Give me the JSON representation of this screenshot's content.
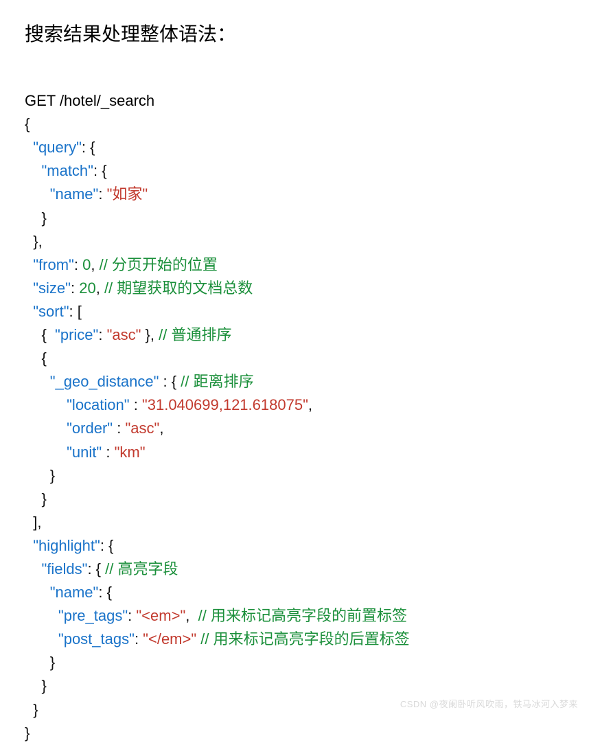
{
  "title": "搜索结果处理整体语法：",
  "request_line": "GET /hotel/_search",
  "braces": {
    "open": "{",
    "close": "}",
    "open_bracket": "[",
    "close_bracket": "]"
  },
  "punct": {
    "colon_space": ": ",
    "colon_space_brace": ": {",
    "colon_space_bracket": ": [",
    "comma": ",",
    "brace_close_comma": "},",
    "bracket_close_comma": "],",
    "space_brace_close_comma": " },",
    "space_colon_space_brace": " : {",
    "space_colon_space": " : ",
    "space": "  "
  },
  "keys": {
    "query": "\"query\"",
    "match": "\"match\"",
    "name": "\"name\"",
    "from": "\"from\"",
    "size": "\"size\"",
    "sort": "\"sort\"",
    "price": "\"price\"",
    "geo_distance": "\"_geo_distance\"",
    "location": "\"location\"",
    "order": "\"order\"",
    "unit": "\"unit\"",
    "highlight": "\"highlight\"",
    "fields": "\"fields\"",
    "pre_tags": "\"pre_tags\"",
    "post_tags": "\"post_tags\""
  },
  "values": {
    "rujia": "\"如家\"",
    "zero": "0",
    "twenty": "20",
    "asc": "\"asc\"",
    "location_val": "\"31.040699,121.618075\"",
    "km": "\"km\"",
    "em_open": "\"<em>\"",
    "em_close": "\"</em>\""
  },
  "comments": {
    "from": "// 分页开始的位置",
    "size": "// 期望获取的文档总数",
    "price_sort": "// 普通排序",
    "geo_sort": "// 距离排序",
    "fields": "// 高亮字段",
    "pre_tags": "// 用来标记高亮字段的前置标签",
    "post_tags": "// 用来标记高亮字段的后置标签"
  },
  "watermark": "CSDN @夜阑卧听风吹雨，铁马冰河入梦来"
}
